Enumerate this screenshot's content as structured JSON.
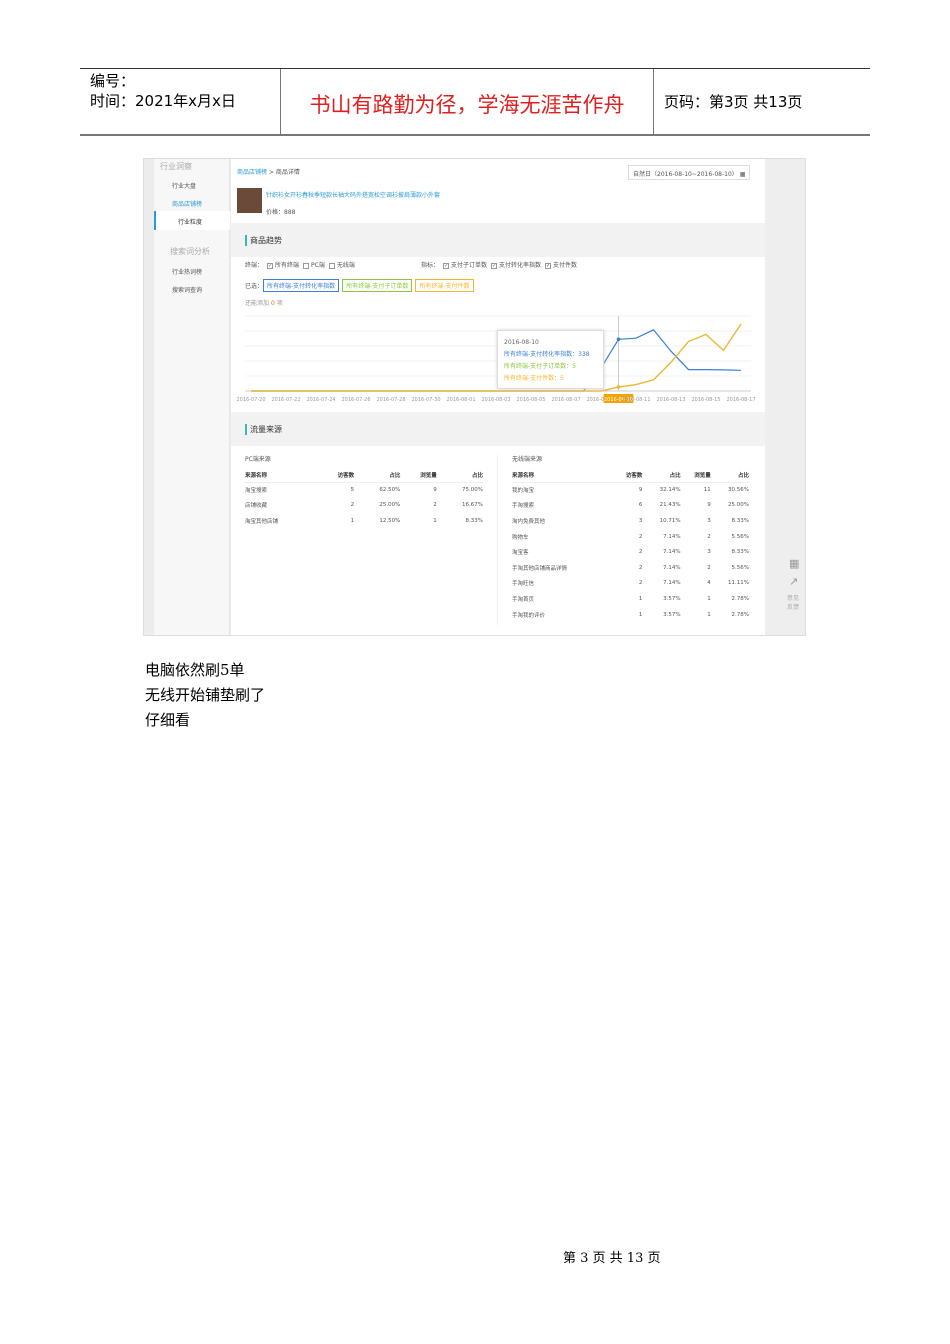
{
  "header": {
    "number_label": "编号：",
    "time_label": "时间：2021年x月x日",
    "motto": "书山有路勤为径，学海无涯苦作舟",
    "page_label": "页码：第3页 共13页"
  },
  "shot": {
    "sidebar": {
      "group1": "行业洞察",
      "item1": "行业大盘",
      "item2": "商品店铺榜",
      "item3": "行业粒度",
      "group2": "搜索词分析",
      "item4": "行业热词榜",
      "item5": "搜索词查询"
    },
    "breadcrumb": [
      "商品店铺榜",
      "商品详情"
    ],
    "date_range": "自然日（2016-08-10~2016-08-10）",
    "product": {
      "title": "针织衫女开衫春秋季短款长袖大码外搭宽松空调衫披肩薄款小外套",
      "price": "价格：888"
    },
    "trend": {
      "title": "商品趋势",
      "terminal_label": "终端：",
      "terminals": [
        {
          "label": "所有终端",
          "checked": true
        },
        {
          "label": "PC端",
          "checked": false
        },
        {
          "label": "无线端",
          "checked": false
        }
      ],
      "metric_label": "指标：",
      "metrics": [
        {
          "label": "支付子订单数",
          "checked": true
        },
        {
          "label": "支付转化率指数",
          "checked": true
        },
        {
          "label": "支付件数",
          "checked": true
        }
      ],
      "selected_label": "已选：",
      "selected": [
        "所有终端-支付转化率指数",
        "所有终端-支付子订单数",
        "所有终端-支付件数"
      ],
      "hint_pre": "还能添加",
      "hint_count": "0",
      "hint_post": "项"
    },
    "colors": {
      "blue": "#3d7fd8",
      "green": "#8cc63f",
      "orange": "#f5b731",
      "accent": "#2a9bd6"
    },
    "tooltip": {
      "date": "2016-08-10",
      "rows": [
        {
          "label": "所有终端-支付转化率指数：",
          "value": "338"
        },
        {
          "label": "所有终端-支付子订单数：",
          "value": "5"
        },
        {
          "label": "所有终端-支付件数：",
          "value": "5"
        }
      ]
    },
    "traffic": {
      "title": "流量来源",
      "pc": {
        "title": "PC端来源",
        "headers": [
          "来源名称",
          "访客数",
          "占比",
          "浏览量",
          "占比"
        ],
        "rows": [
          [
            "淘宝搜索",
            "5",
            "62.50%",
            "9",
            "75.00%"
          ],
          [
            "店铺收藏",
            "2",
            "25.00%",
            "2",
            "16.67%"
          ],
          [
            "淘宝其他店铺",
            "1",
            "12.50%",
            "1",
            "8.33%"
          ]
        ]
      },
      "mobile": {
        "title": "无线端来源",
        "headers": [
          "来源名称",
          "访客数",
          "占比",
          "浏览量",
          "占比"
        ],
        "rows": [
          [
            "我的淘宝",
            "9",
            "32.14%",
            "11",
            "30.56%"
          ],
          [
            "手淘搜索",
            "6",
            "21.43%",
            "9",
            "25.00%"
          ],
          [
            "淘内免费其他",
            "3",
            "10.71%",
            "3",
            "8.33%"
          ],
          [
            "购物车",
            "2",
            "7.14%",
            "2",
            "5.56%"
          ],
          [
            "淘宝客",
            "2",
            "7.14%",
            "3",
            "8.33%"
          ],
          [
            "手淘其他店铺商品详情",
            "2",
            "7.14%",
            "2",
            "5.56%"
          ],
          [
            "手淘旺信",
            "2",
            "7.14%",
            "4",
            "11.11%"
          ],
          [
            "手淘首页",
            "1",
            "3.57%",
            "1",
            "2.78%"
          ],
          [
            "手淘我的评价",
            "1",
            "3.57%",
            "1",
            "2.78%"
          ]
        ]
      }
    },
    "feedback": "意见反馈"
  },
  "chart_data": {
    "type": "line",
    "x_ticks": [
      "2016-07-20",
      "2016-07-22",
      "2016-07-24",
      "2016-07-26",
      "2016-07-28",
      "2016-07-30",
      "2016-08-01",
      "2016-08-03",
      "2016-08-05",
      "2016-08-07",
      "2016-08-09",
      "2016-08-10",
      "2016-08-11",
      "2016-08-13",
      "2016-08-15",
      "2016-08-17"
    ],
    "highlight": "2016-08-10",
    "x_start": "2016-07-20",
    "days": 29,
    "series": [
      {
        "name": "所有终端-支付转化率指数",
        "color": "#3d7fd8",
        "axis": "left",
        "values": [
          0,
          0,
          0,
          0,
          0,
          0,
          0,
          0,
          0,
          0,
          0,
          0,
          0,
          0,
          0,
          0,
          0,
          0,
          0,
          0,
          150,
          338,
          345,
          400,
          260,
          140,
          140,
          138,
          135
        ]
      },
      {
        "name": "所有终端-支付子订单数",
        "color": "#8cc63f",
        "axis": "right",
        "values": [
          0,
          0,
          0,
          0,
          0,
          0,
          0,
          0,
          0,
          0,
          0,
          0,
          0,
          0,
          0,
          0,
          0,
          0,
          0,
          0,
          0,
          5,
          8,
          14,
          36,
          62,
          71,
          51,
          84
        ]
      },
      {
        "name": "所有终端-支付件数",
        "color": "#f5b731",
        "axis": "right",
        "values": [
          0,
          0,
          0,
          0,
          0,
          0,
          0,
          0,
          0,
          0,
          0,
          0,
          0,
          0,
          0,
          0,
          0,
          0,
          0,
          0,
          0,
          5,
          8,
          14,
          36,
          62,
          71,
          51,
          84
        ]
      }
    ],
    "ylim_left": [
      0,
      490
    ],
    "ylim_right": [
      0,
      94
    ]
  },
  "body": {
    "lines": [
      "电脑依然刷5单",
      "无线开始铺垫刷了",
      "仔细看"
    ]
  },
  "footer": "第 3 页 共 13 页"
}
